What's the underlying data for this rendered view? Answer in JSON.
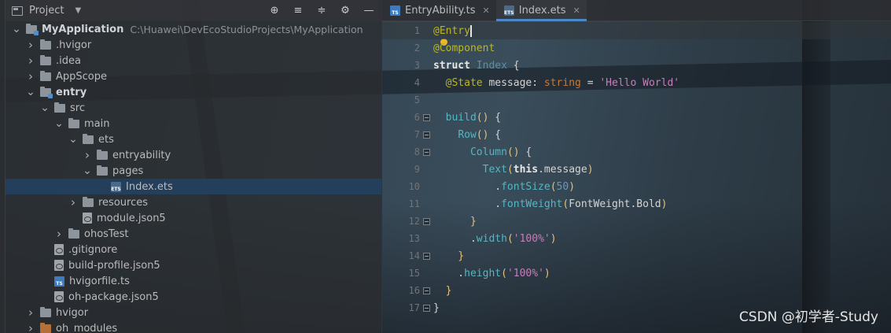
{
  "colors": {
    "selection": "#24405e",
    "tab_accent": "#4a88c7",
    "annotation": "#bbb529",
    "keyword": "#cc7832",
    "string": "#a5c25c",
    "method": "#56b6c2",
    "number": "#6897bb"
  },
  "project_panel": {
    "title": "Project",
    "tools": [
      "locate-icon",
      "expand-all-icon",
      "collapse-all-icon",
      "gear-icon",
      "hide-icon"
    ]
  },
  "tree": [
    {
      "label": "MyApplication",
      "path_hint": "C:\\Huawei\\DevEcoStudioProjects\\MyApplication",
      "depth": 0,
      "expanded": true,
      "icon": "module-folder"
    },
    {
      "label": ".hvigor",
      "depth": 1,
      "expanded": false,
      "icon": "folder"
    },
    {
      "label": ".idea",
      "depth": 1,
      "expanded": false,
      "icon": "folder"
    },
    {
      "label": "AppScope",
      "depth": 1,
      "expanded": false,
      "icon": "folder"
    },
    {
      "label": "entry",
      "depth": 1,
      "expanded": true,
      "icon": "module-folder"
    },
    {
      "label": "src",
      "depth": 2,
      "expanded": true,
      "icon": "folder"
    },
    {
      "label": "main",
      "depth": 3,
      "expanded": true,
      "icon": "folder"
    },
    {
      "label": "ets",
      "depth": 4,
      "expanded": true,
      "icon": "folder"
    },
    {
      "label": "entryability",
      "depth": 5,
      "expanded": false,
      "icon": "folder"
    },
    {
      "label": "pages",
      "depth": 5,
      "expanded": true,
      "icon": "folder"
    },
    {
      "label": "Index.ets",
      "depth": 6,
      "icon": "ets-file",
      "selected": true
    },
    {
      "label": "resources",
      "depth": 4,
      "expanded": false,
      "icon": "folder"
    },
    {
      "label": "module.json5",
      "depth": 4,
      "icon": "json-file"
    },
    {
      "label": "ohosTest",
      "depth": 3,
      "expanded": false,
      "icon": "folder"
    },
    {
      "label": ".gitignore",
      "depth": 2,
      "icon": "json-file"
    },
    {
      "label": "build-profile.json5",
      "depth": 2,
      "icon": "json-file"
    },
    {
      "label": "hvigorfile.ts",
      "depth": 2,
      "icon": "ts-file"
    },
    {
      "label": "oh-package.json5",
      "depth": 2,
      "icon": "json-file"
    },
    {
      "label": "hvigor",
      "depth": 1,
      "expanded": false,
      "icon": "folder"
    },
    {
      "label": "oh_modules",
      "depth": 1,
      "expanded": false,
      "icon": "excluded-folder"
    }
  ],
  "tabs": [
    {
      "label": "EntryAbility.ts",
      "icon": "ts-file",
      "active": false
    },
    {
      "label": "Index.ets",
      "icon": "ets-file",
      "active": true
    }
  ],
  "code": {
    "line_numbers": [
      "1",
      "2",
      "3",
      "4",
      "5",
      "6",
      "7",
      "8",
      "9",
      "10",
      "11",
      "12",
      "13",
      "14",
      "15",
      "16",
      "17"
    ],
    "fold_lines": [
      6,
      7,
      8,
      12,
      14,
      16,
      17
    ],
    "lines": [
      [
        [
          "t-ann",
          "@Entry"
        ]
      ],
      [
        [
          "t-ann",
          "@Component"
        ]
      ],
      [
        [
          "t-kwb",
          "struct "
        ],
        [
          "t-name",
          "Index"
        ],
        [
          "t-plain",
          " {"
        ]
      ],
      [
        [
          "t-plain",
          "  "
        ],
        [
          "t-ann",
          "@State"
        ],
        [
          "t-plain",
          " message: "
        ],
        [
          "t-type",
          "string"
        ],
        [
          "t-plain",
          " = "
        ],
        [
          "t-str2",
          "'Hello World'"
        ]
      ],
      [],
      [
        [
          "t-plain",
          "  "
        ],
        [
          "t-fn",
          "build"
        ],
        [
          "t-paren",
          "()"
        ],
        [
          "t-plain",
          " {"
        ]
      ],
      [
        [
          "t-plain",
          "    "
        ],
        [
          "t-fn",
          "Row"
        ],
        [
          "t-paren",
          "()"
        ],
        [
          "t-plain",
          " {"
        ]
      ],
      [
        [
          "t-plain",
          "      "
        ],
        [
          "t-fn",
          "Column"
        ],
        [
          "t-paren",
          "()"
        ],
        [
          "t-plain",
          " {"
        ]
      ],
      [
        [
          "t-plain",
          "        "
        ],
        [
          "t-fn",
          "Text"
        ],
        [
          "t-paren",
          "("
        ],
        [
          "t-kwb",
          "this"
        ],
        [
          "t-plain",
          ".message"
        ],
        [
          "t-paren",
          ")"
        ]
      ],
      [
        [
          "t-plain",
          "          ."
        ],
        [
          "t-fn",
          "fontSize"
        ],
        [
          "t-paren",
          "("
        ],
        [
          "t-num",
          "50"
        ],
        [
          "t-paren",
          ")"
        ]
      ],
      [
        [
          "t-plain",
          "          ."
        ],
        [
          "t-fn",
          "fontWeight"
        ],
        [
          "t-paren",
          "("
        ],
        [
          "t-plain",
          "FontWeight.Bold"
        ],
        [
          "t-paren",
          ")"
        ]
      ],
      [
        [
          "t-plain",
          "      "
        ],
        [
          "t-paren",
          "}"
        ]
      ],
      [
        [
          "t-plain",
          "      ."
        ],
        [
          "t-fn",
          "width"
        ],
        [
          "t-paren",
          "("
        ],
        [
          "t-str2",
          "'100%'"
        ],
        [
          "t-paren",
          ")"
        ]
      ],
      [
        [
          "t-plain",
          "    "
        ],
        [
          "t-paren",
          "}"
        ]
      ],
      [
        [
          "t-plain",
          "    ."
        ],
        [
          "t-fn",
          "height"
        ],
        [
          "t-paren",
          "("
        ],
        [
          "t-str2",
          "'100%'"
        ],
        [
          "t-paren",
          ")"
        ]
      ],
      [
        [
          "t-plain",
          "  "
        ],
        [
          "t-paren",
          "}"
        ]
      ],
      [
        [
          "t-plain",
          "}"
        ]
      ]
    ]
  },
  "watermark": "CSDN @初学者-Study"
}
